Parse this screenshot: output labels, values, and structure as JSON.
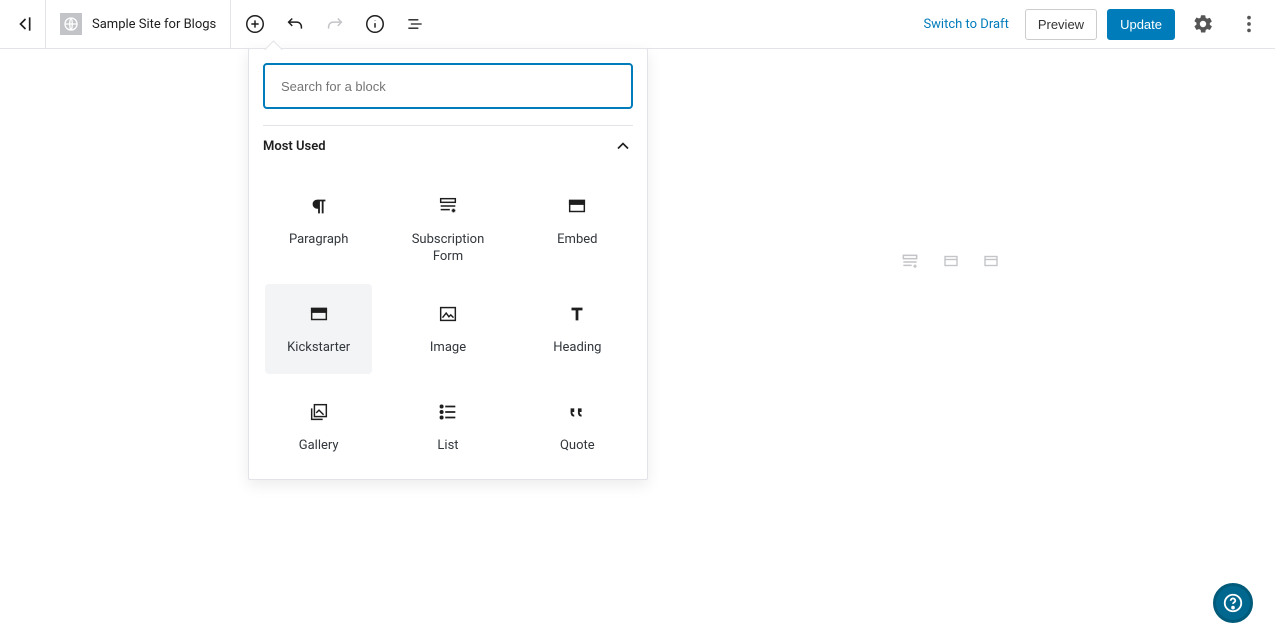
{
  "toolbar": {
    "site_title": "Sample Site for Blogs",
    "switch_draft": "Switch to Draft",
    "preview": "Preview",
    "update": "Update"
  },
  "inserter": {
    "search_placeholder": "Search for a block",
    "section_title": "Most Used",
    "blocks": [
      {
        "name": "Paragraph",
        "icon": "paragraph"
      },
      {
        "name": "Subscription Form",
        "icon": "form"
      },
      {
        "name": "Embed",
        "icon": "embed"
      },
      {
        "name": "Kickstarter",
        "icon": "embed",
        "hovered": true
      },
      {
        "name": "Image",
        "icon": "image"
      },
      {
        "name": "Heading",
        "icon": "heading"
      },
      {
        "name": "Gallery",
        "icon": "gallery"
      },
      {
        "name": "List",
        "icon": "list"
      },
      {
        "name": "Quote",
        "icon": "quote"
      }
    ]
  }
}
